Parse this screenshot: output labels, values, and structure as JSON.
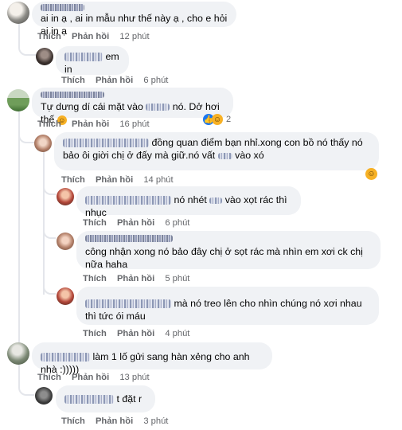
{
  "actions": {
    "like": "Thích",
    "reply": "Phản hồi"
  },
  "comments": [
    {
      "text": "ai in ạ , ai in mẫu như thế này ạ , cho e hỏi ai in ạ",
      "time": "12 phút"
    },
    {
      "text": "em in",
      "time": "6 phút"
    },
    {
      "text": "Tự dưng dí cái mặt vào",
      "text2": "nó. Dở hơi thế",
      "time": "16 phút",
      "reaction_count": "2"
    },
    {
      "text": "đồng quan điểm bạn nhỉ.xong con bồ nó thấy nó bảo ôi giời chị ở đấy mà giữ.nó vất",
      "text2": "vào xó",
      "time": "14 phút"
    },
    {
      "text": "nó nhét",
      "text2": "vào xọt rác thì nhục",
      "time": "6 phút"
    },
    {
      "text": "công nhận xong nó bảo đây chị ở sọt rác mà nhìn em xơi ck chị nữa haha",
      "time": "5 phút"
    },
    {
      "text": "mà nó treo lên cho nhìn chúng nó xơi nhau thì tức ói máu",
      "time": "4 phút"
    },
    {
      "text": "làm 1 lố gửi sang hàn xẻng cho anh nhà :)))))",
      "time": "13 phút"
    },
    {
      "text": "t đặt r",
      "time": "3 phút"
    }
  ],
  "colors": {
    "bubble": "#f0f2f5",
    "meta": "#65676b",
    "like": "#1877f2",
    "haha": "#f7b125"
  },
  "icons": [
    "like-icon",
    "haha-icon"
  ]
}
